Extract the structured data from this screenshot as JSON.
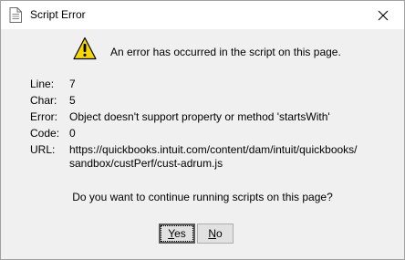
{
  "window": {
    "title": "Script Error"
  },
  "message": "An error has occurred in the script on this page.",
  "fields": [
    {
      "label": "Line:",
      "value": "7"
    },
    {
      "label": "Char:",
      "value": "5"
    },
    {
      "label": "Error:",
      "value": "Object doesn't support property or method 'startsWith'"
    },
    {
      "label": "Code:",
      "value": "0"
    },
    {
      "label": "URL:",
      "value_line1": "https://quickbooks.intuit.com/content/dam/intuit/quickbooks/",
      "value_line2": "sandbox/custPerf/cust-adrum.js"
    }
  ],
  "question": "Do you want to continue running scripts on this page?",
  "buttons": {
    "yes": {
      "label_rest": "es",
      "mnemonic": "Y"
    },
    "no": {
      "label_rest": "o",
      "mnemonic": "N"
    }
  },
  "icons": {
    "title": "script-page-icon",
    "close": "close-icon",
    "warning": "warning-icon"
  },
  "colors": {
    "warning_fill": "#f5d800",
    "dialog_bg": "#f0f0f0"
  }
}
